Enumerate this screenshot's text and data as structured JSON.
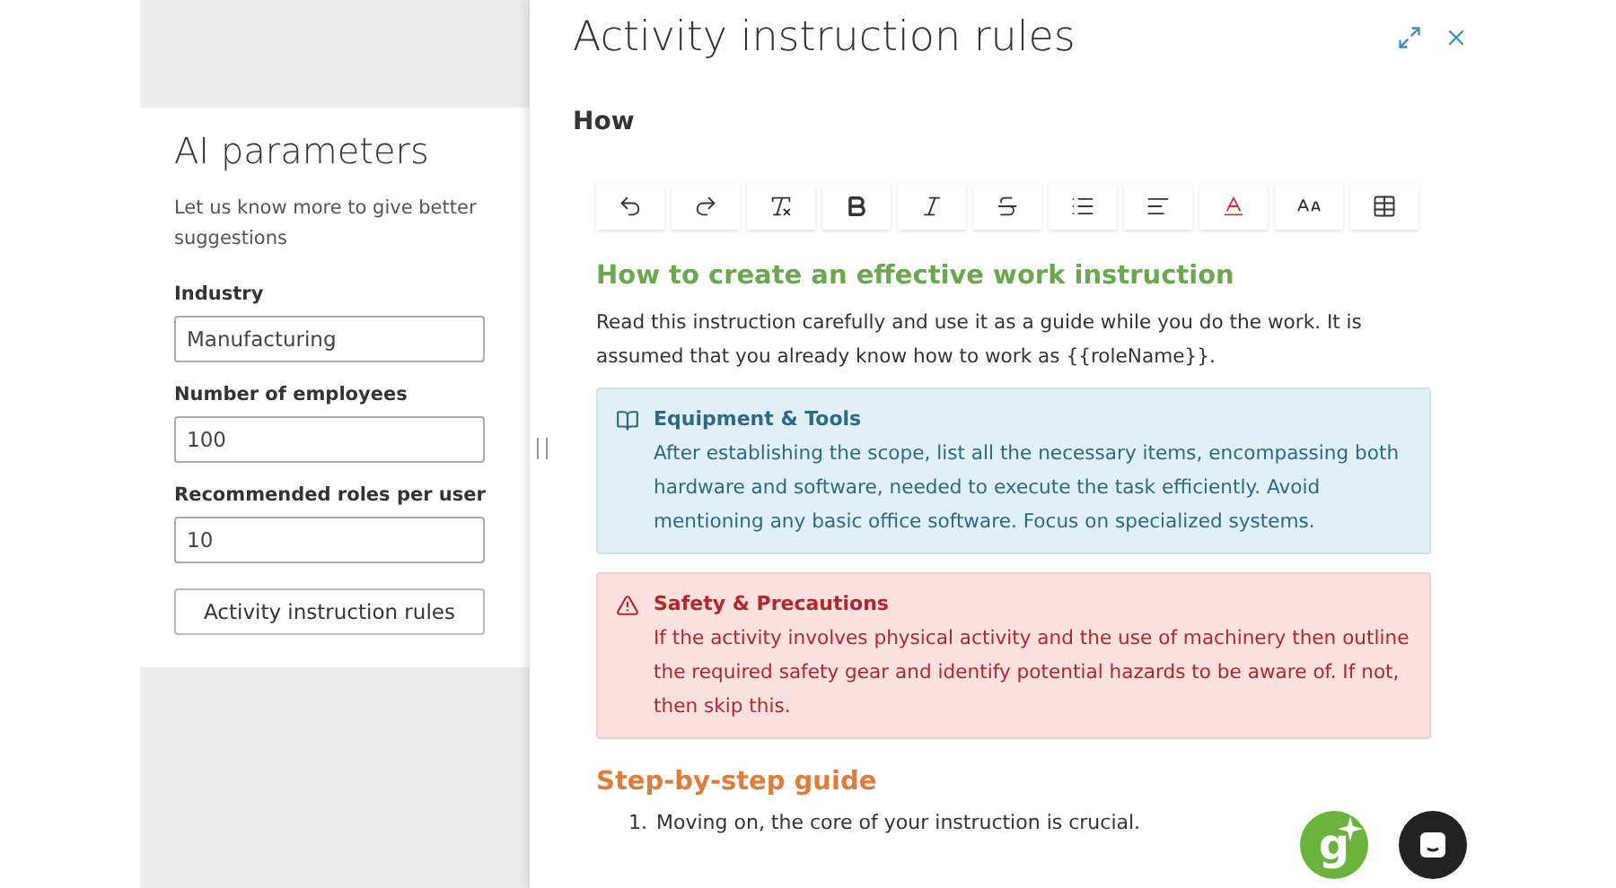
{
  "params_panel": {
    "title": "AI parameters",
    "description": "Let us know more to give better suggestions",
    "fields": [
      {
        "label": "Industry",
        "value": "Manufacturing"
      },
      {
        "label": "Number of employees",
        "value": "100"
      },
      {
        "label": "Recommended roles per user",
        "value": "10"
      }
    ],
    "button": "Activity instruction rules"
  },
  "drawer": {
    "title": "Activity instruction rules",
    "section_label": "How",
    "toolbar": [
      {
        "kind": "undo"
      },
      {
        "kind": "redo"
      },
      {
        "kind": "clear-format"
      },
      {
        "kind": "bold"
      },
      {
        "kind": "italic"
      },
      {
        "kind": "strike"
      },
      {
        "kind": "list"
      },
      {
        "kind": "align"
      },
      {
        "kind": "font-color"
      },
      {
        "kind": "font-size"
      },
      {
        "kind": "table"
      }
    ],
    "content": [
      {
        "kind": "heading",
        "color": "#6aa84f",
        "text": "How to create an effective work instruction"
      },
      {
        "kind": "paragraph",
        "text": "Read this instruction carefully and use it as a guide while you do the work. It is assumed that you already know how to work as {{roleName}}."
      },
      {
        "kind": "info_callout",
        "title": "Equipment & Tools",
        "text": "After establishing the scope, list all the necessary items, encompassing both hardware and software, needed to execute the task efficiently. Avoid mentioning any basic office software. Focus on specialized systems."
      },
      {
        "kind": "warning_callout",
        "title": "Safety & Precautions",
        "text": "If the activity involves physical activity and the use of machinery then outline the required safety gear and identify potential hazards to be aware of. If not, then skip this."
      },
      {
        "kind": "heading",
        "color": "#e07b39",
        "text": "Step-by-step guide"
      },
      {
        "kind": "list_item",
        "number": "1.",
        "text": "Moving on, the core of your instruction is crucial."
      }
    ]
  },
  "assistant_logo": "g"
}
